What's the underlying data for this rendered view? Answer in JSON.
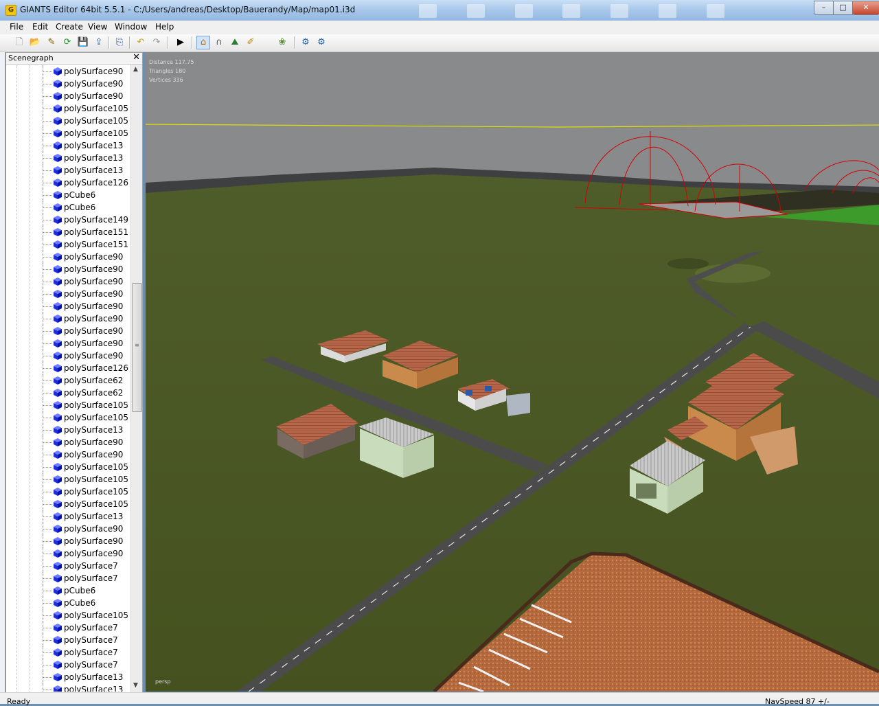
{
  "window": {
    "title": "GIANTS Editor 64bit 5.5.1 - C:/Users/andreas/Desktop/Bauerandy/Map/map01.i3d",
    "app_icon_letter": "G",
    "minimize": "–",
    "maximize": "□",
    "close": "✕"
  },
  "menu": {
    "items": [
      "File",
      "Edit",
      "Create",
      "View",
      "Window",
      "Help"
    ]
  },
  "toolbar": {
    "buttons": [
      {
        "name": "new-file-icon",
        "glyph": "🗋"
      },
      {
        "name": "open-folder-icon",
        "glyph": "📂"
      },
      {
        "name": "edit-script-icon",
        "glyph": "✎"
      },
      {
        "name": "reload-icon",
        "glyph": "⟳"
      },
      {
        "name": "save-icon",
        "glyph": "💾"
      },
      {
        "name": "export-icon",
        "glyph": "⇪"
      },
      {
        "name": "import-icon",
        "glyph": "⎘"
      },
      {
        "name": "undo-icon",
        "glyph": "↶"
      },
      {
        "name": "redo-icon",
        "glyph": "↷"
      },
      {
        "name": "play-icon",
        "glyph": "▶"
      },
      {
        "name": "select-mode-icon",
        "glyph": "⌂"
      },
      {
        "name": "magnet-icon",
        "glyph": "∩"
      },
      {
        "name": "terrain-sculpt-icon",
        "glyph": "⛰"
      },
      {
        "name": "terrain-paint-icon",
        "glyph": "✐"
      },
      {
        "name": "foliage-paint-icon",
        "glyph": "❀"
      },
      {
        "name": "settings-cycle-icon",
        "glyph": "⚙"
      },
      {
        "name": "settings-gear-icon",
        "glyph": "⚙"
      }
    ]
  },
  "scenegraph": {
    "title": "Scenegraph",
    "close": "✕",
    "nodes": [
      "polySurface90",
      "polySurface90",
      "polySurface90",
      "polySurface105",
      "polySurface105",
      "polySurface105",
      "polySurface13",
      "polySurface13",
      "polySurface13",
      "polySurface126",
      "pCube6",
      "pCube6",
      "polySurface149",
      "polySurface151",
      "polySurface151",
      "polySurface90",
      "polySurface90",
      "polySurface90",
      "polySurface90",
      "polySurface90",
      "polySurface90",
      "polySurface90",
      "polySurface90",
      "polySurface90",
      "polySurface126",
      "polySurface62",
      "polySurface62",
      "polySurface105",
      "polySurface105",
      "polySurface13",
      "polySurface90",
      "polySurface90",
      "polySurface105",
      "polySurface105",
      "polySurface105",
      "polySurface105",
      "polySurface13",
      "polySurface90",
      "polySurface90",
      "polySurface90",
      "polySurface7",
      "polySurface7",
      "pCube6",
      "pCube6",
      "polySurface105",
      "polySurface7",
      "polySurface7",
      "polySurface7",
      "polySurface7",
      "polySurface13",
      "polySurface13"
    ]
  },
  "viewport": {
    "stats": {
      "distance": "Distance 117.75",
      "triangles": "Triangles 180",
      "vertices": "Vertices 336"
    },
    "camera": "persp",
    "colors": {
      "sky": "#898a8c",
      "grass": "#4d5b27",
      "road": "#4a4a4a",
      "selection": "#d40000"
    }
  },
  "status": {
    "left": "Ready",
    "right": "NavSpeed 87 +/-"
  }
}
